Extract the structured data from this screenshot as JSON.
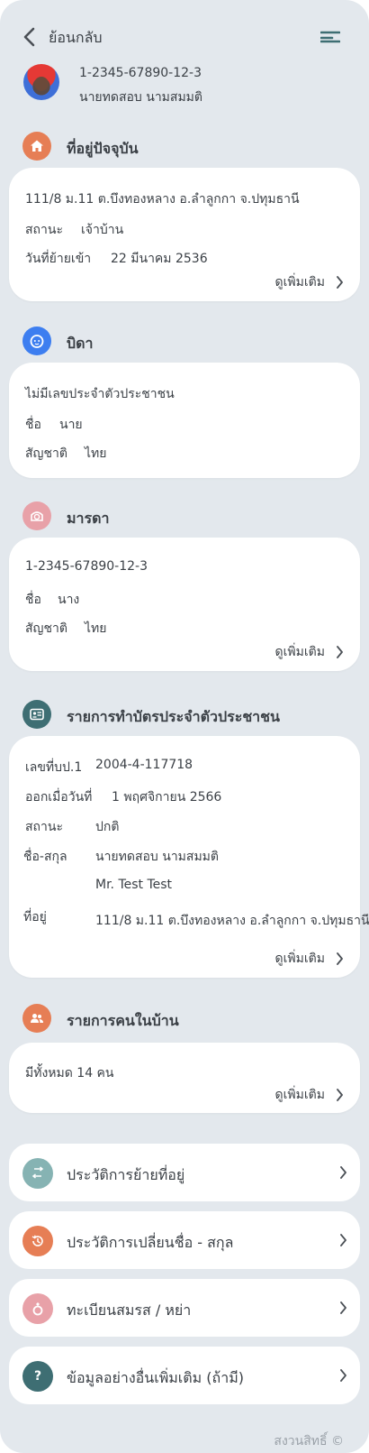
{
  "header": {
    "back_label": "ย้อนกลับ"
  },
  "profile": {
    "id": "1-2345-67890-12-3",
    "name": "นายทดสอบ  นามสมมติ"
  },
  "address": {
    "title": "ที่อยู่ปัจจุบัน",
    "full": "111/8 ม.11 ต.บึงทองหลาง อ.ลำลูกกา จ.ปทุมธานี",
    "status_label": "สถานะ",
    "status_value": "เจ้าบ้าน",
    "move_label": "วันที่ย้ายเข้า",
    "move_value": "22 มีนาคม 2536",
    "more": "ดูเพิ่มเติม"
  },
  "father": {
    "title": "บิดา",
    "id_text": "ไม่มีเลขประจำตัวประชาชน",
    "name_label": "ชื่อ",
    "name_value": "นาย",
    "nat_label": "สัญชาติ",
    "nat_value": "ไทย"
  },
  "mother": {
    "title": "มารดา",
    "id_text": "1-2345-67890-12-3",
    "name_label": "ชื่อ",
    "name_value": "นาง",
    "nat_label": "สัญชาติ",
    "nat_value": "ไทย",
    "more": "ดูเพิ่มเติม"
  },
  "idcard": {
    "title": "รายการทำบัตรประจำตัวประชาชน",
    "no_label": "เลขที่บป.1",
    "no_value": "2004-4-117718",
    "issued_label": "ออกเมื่อวันที่",
    "issued_value": "1 พฤศจิกายน 2566",
    "status_label": "สถานะ",
    "status_value": "ปกติ",
    "name_label": "ชื่อ-สกุล",
    "name_th": "นายทดสอบ  นามสมมติ",
    "name_en": "Mr. Test  Test",
    "addr_label": "ที่อยู่",
    "addr_value": "111/8 ม.11 ต.บึงทองหลาง อ.ลำลูกกา จ.ปทุมธานี",
    "more": "ดูเพิ่มเติม"
  },
  "household": {
    "title": "รายการคนในบ้าน",
    "count_text": "มีทั้งหมด  14  คน",
    "more": "ดูเพิ่มเติม"
  },
  "menu": [
    {
      "label": "ประวัติการย้ายที่อยู่",
      "icon": "swap-icon",
      "color": "#86b3b3"
    },
    {
      "label": "ประวัติการเปลี่ยนชื่อ - สกุล",
      "icon": "history-icon",
      "color": "#e67e55"
    },
    {
      "label": "ทะเบียนสมรส / หย่า",
      "icon": "ring-icon",
      "color": "#e8a1a8"
    },
    {
      "label": "ข้อมูลอย่างอื่นเพิ่มเติม (ถ้ามี)",
      "icon": "question-icon",
      "color": "#3e6e73"
    }
  ],
  "footer": {
    "text": "สงวนสิทธิ์ ©"
  },
  "colors": {
    "background": "#e3e8ed",
    "orange": "#e67e55",
    "blue": "#3d7ef0",
    "pink": "#e8a1a8",
    "teal": "#3e6e73"
  }
}
